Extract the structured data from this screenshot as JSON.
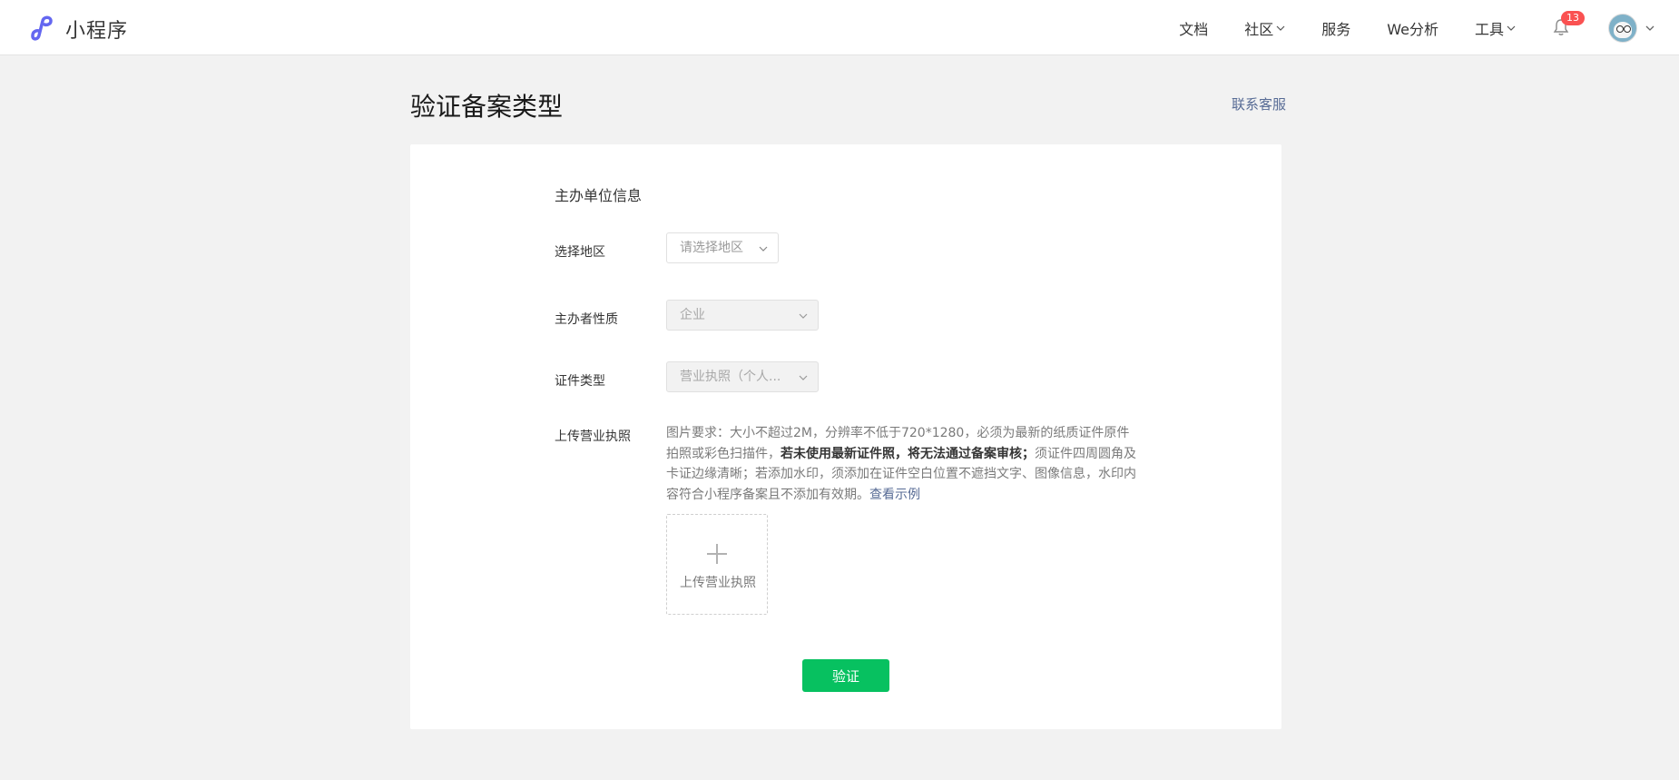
{
  "brand": {
    "name": "小程序",
    "logo_icon": "mini-program-logo-icon",
    "color": "#6467f0"
  },
  "nav": {
    "items": [
      {
        "label": "文档",
        "has_dropdown": false
      },
      {
        "label": "社区",
        "has_dropdown": true
      },
      {
        "label": "服务",
        "has_dropdown": false
      },
      {
        "label": "We分析",
        "has_dropdown": false
      },
      {
        "label": "工具",
        "has_dropdown": true
      }
    ],
    "notifications": {
      "icon": "bell-icon",
      "count": "13"
    },
    "avatar": {
      "icon": "avatar"
    }
  },
  "page": {
    "title": "验证备案类型",
    "contact_label": "联系客服"
  },
  "form": {
    "section_title": "主办单位信息",
    "region": {
      "label": "选择地区",
      "placeholder": "请选择地区"
    },
    "organizer_type": {
      "label": "主办者性质",
      "value": "企业"
    },
    "certificate_type": {
      "label": "证件类型",
      "value": "营业执照（个人..."
    },
    "upload": {
      "label": "上传营业执照",
      "desc_normal_1": "图片要求：大小不超过2M，分辨率不低于720*1280，必须为最新的纸质证件原件拍照或彩色扫描件，",
      "desc_bold": "若未使用最新证件照，将无法通过备案审核；",
      "desc_normal_2": "须证件四周圆角及卡证边缘清晰；若添加水印，须添加在证件空白位置不遮挡文字、图像信息，水印内容符合小程序备案且不添加有效期。",
      "example_link": "查看示例",
      "button_label": "上传营业执照"
    },
    "submit_label": "验证"
  },
  "colors": {
    "primary_green": "#07c160",
    "link_blue": "#576b95",
    "badge_red": "#fa5151",
    "background": "#f2f2f2"
  }
}
